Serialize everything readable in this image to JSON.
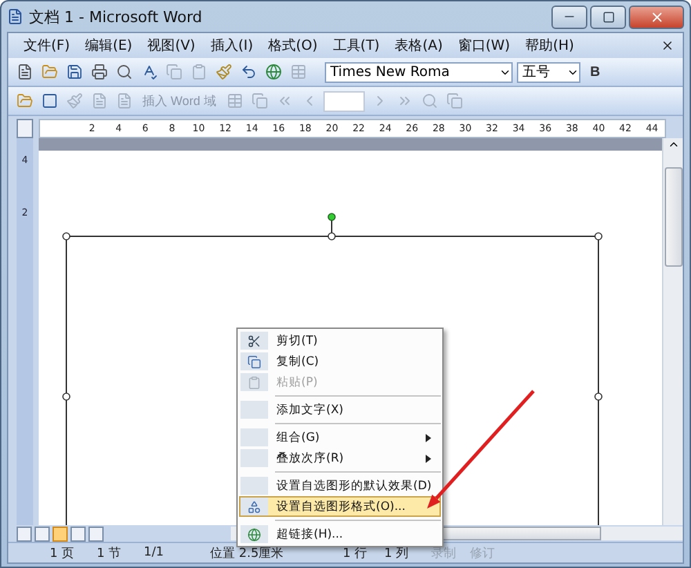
{
  "window": {
    "title": "文档 1 - Microsoft Word"
  },
  "menu": [
    {
      "label": "文件(F)"
    },
    {
      "label": "编辑(E)"
    },
    {
      "label": "视图(V)"
    },
    {
      "label": "插入(I)"
    },
    {
      "label": "格式(O)"
    },
    {
      "label": "工具(T)"
    },
    {
      "label": "表格(A)"
    },
    {
      "label": "窗口(W)"
    },
    {
      "label": "帮助(H)"
    }
  ],
  "formatting": {
    "font": "Times New Roma",
    "size": "五号",
    "bold": "B"
  },
  "drawing_toolbar": {
    "field_button": "插入 Word 域"
  },
  "ruler": {
    "ticks": [
      "2",
      "4",
      "6",
      "8",
      "10",
      "12",
      "14",
      "16",
      "18",
      "20",
      "22",
      "24",
      "26",
      "28",
      "30",
      "32",
      "34",
      "36",
      "38",
      "40",
      "42",
      "44"
    ],
    "vertical_ticks": [
      "4",
      "2"
    ]
  },
  "context_menu": [
    {
      "kind": "item",
      "label": "剪切(T)",
      "disabled": false,
      "selected": false,
      "submenu": false
    },
    {
      "kind": "item",
      "label": "复制(C)",
      "disabled": false,
      "selected": false,
      "submenu": false
    },
    {
      "kind": "item",
      "label": "粘贴(P)",
      "disabled": true,
      "selected": false,
      "submenu": false
    },
    {
      "kind": "separator"
    },
    {
      "kind": "item",
      "label": "添加文字(X)",
      "disabled": false,
      "selected": false,
      "submenu": false
    },
    {
      "kind": "separator"
    },
    {
      "kind": "item",
      "label": "组合(G)",
      "disabled": false,
      "selected": false,
      "submenu": true
    },
    {
      "kind": "item",
      "label": "叠放次序(R)",
      "disabled": false,
      "selected": false,
      "submenu": true
    },
    {
      "kind": "separator"
    },
    {
      "kind": "item",
      "label": "设置自选图形的默认效果(D)",
      "disabled": false,
      "selected": false,
      "submenu": false
    },
    {
      "kind": "item",
      "label": "设置自选图形格式(O)...",
      "disabled": false,
      "selected": true,
      "submenu": false
    },
    {
      "kind": "separator"
    },
    {
      "kind": "item",
      "label": "超链接(H)...",
      "disabled": false,
      "selected": false,
      "submenu": false
    }
  ],
  "status_bar": [
    {
      "label": "1 页",
      "disabled": false
    },
    {
      "label": "1 节",
      "disabled": false
    },
    {
      "label": "1/1",
      "disabled": false
    },
    {
      "label": "位置 2.5厘米",
      "disabled": false
    },
    {
      "label": "1 行",
      "disabled": false
    },
    {
      "label": "1 列",
      "disabled": false
    },
    {
      "label": "录制",
      "disabled": true
    },
    {
      "label": "修订",
      "disabled": true
    }
  ]
}
